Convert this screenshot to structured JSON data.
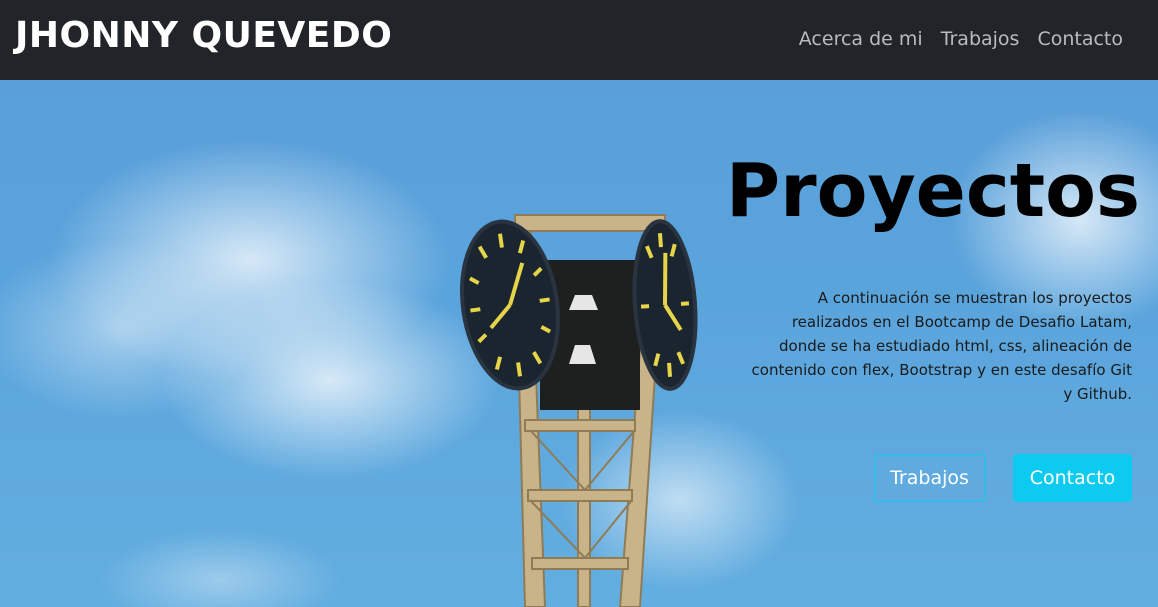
{
  "navbar": {
    "brand": "JHONNY QUEVEDO",
    "links": [
      "Acerca de mi",
      "Trabajos",
      "Contacto"
    ]
  },
  "hero": {
    "title": "Proyectos",
    "description": "A continuación se muestran los proyectos realizados en el Bootcamp de Desafio Latam, donde se ha estudiado html, css, alineación de contenido con flex, Bootstrap y en este desafío Git y Github.",
    "buttons": {
      "primary": "Trabajos",
      "secondary": "Contacto"
    },
    "background_image": "clock-tower-sky"
  },
  "colors": {
    "navbar_bg": "#212529",
    "accent": "#0dcaf0",
    "sky": "#5aa4dc"
  }
}
